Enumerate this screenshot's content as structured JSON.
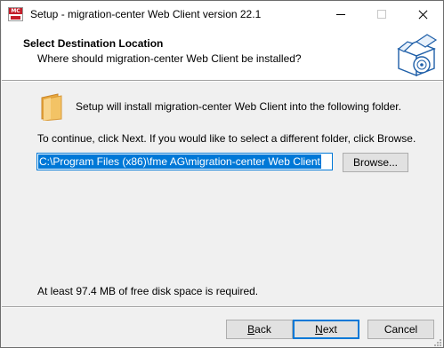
{
  "window": {
    "title": "Setup - migration-center Web Client version 22.1",
    "app_icon_text": "MC",
    "controls": {
      "minimize": "minimize",
      "maximize": "maximize",
      "close": "close"
    }
  },
  "header": {
    "title": "Select Destination Location",
    "subtitle": "Where should migration-center Web Client be installed?"
  },
  "body": {
    "intro": "Setup will install migration-center Web Client into the following folder.",
    "continue_text": "To continue, click Next. If you would like to select a different folder, click Browse.",
    "path_value": "C:\\Program Files (x86)\\fme AG\\migration-center Web Client",
    "browse_label": "Browse...",
    "disk_space": "At least 97.4 MB of free disk space is required."
  },
  "footer": {
    "back_label": "Back",
    "back_mnemonic": "B",
    "back_rest": "ack",
    "next_label": "Next",
    "next_mnemonic": "N",
    "next_rest": "ext",
    "cancel_label": "Cancel"
  },
  "colors": {
    "accent": "#0078d7",
    "window_bg": "#f0f0f0",
    "header_bg": "#ffffff",
    "icon_red": "#c41e2a",
    "folder_yellow": "#f3c365"
  }
}
